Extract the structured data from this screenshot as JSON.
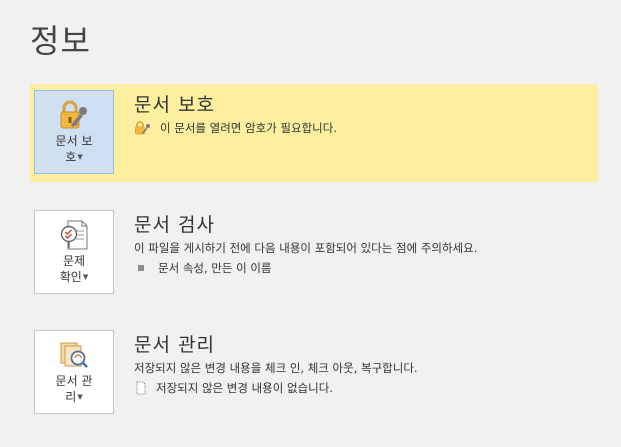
{
  "page": {
    "title": "정보"
  },
  "sections": {
    "protect": {
      "tile_label_line1": "문서 보",
      "tile_label_line2": "호",
      "title": "문서 보호",
      "item": "이 문서를 열려면 암호가 필요합니다.",
      "tile_icon": "lock-key-icon",
      "item_icon": "lock-key-icon"
    },
    "inspect": {
      "tile_label_line1": "문제",
      "tile_label_line2": "확인",
      "title": "문서 검사",
      "desc": "이 파일을 게시하기 전에 다음 내용이 포함되어 있다는 점에 주의하세요.",
      "item": "문서 속성, 만든 이 이름",
      "tile_icon": "inspect-document-icon"
    },
    "manage": {
      "tile_label_line1": "문서 관",
      "tile_label_line2": "리",
      "title": "문서 관리",
      "desc": "저장되지 않은 변경 내용을 체크 인, 체크 아웃, 복구합니다.",
      "item": "저장되지 않은 변경 내용이 없습니다.",
      "tile_icon": "manage-document-icon",
      "item_icon": "document-outline-icon"
    }
  },
  "colors": {
    "highlight": "#fcef9f",
    "selected_tile": "#cfe0f3",
    "background": "#f1f1f1"
  }
}
